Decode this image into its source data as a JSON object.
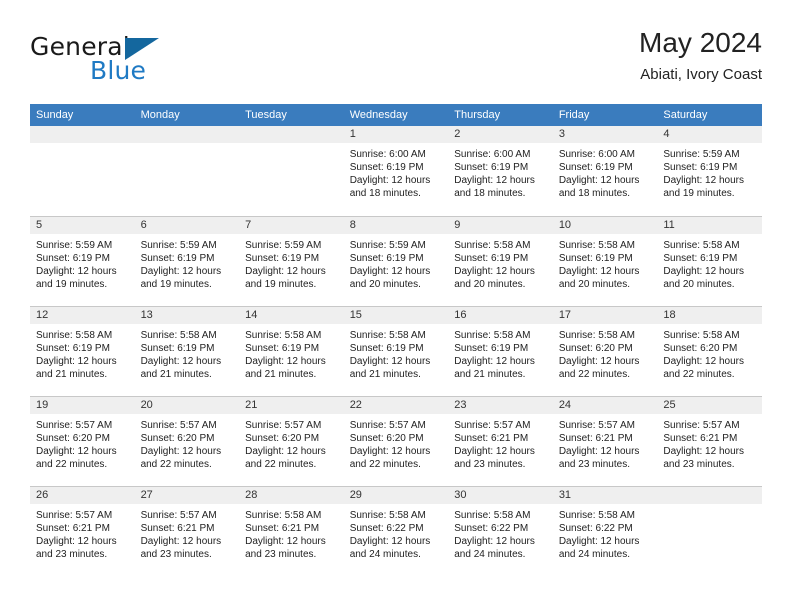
{
  "logo": {
    "text_top": "General",
    "text_bottom": "Blue",
    "icon": "triangle-icon",
    "color_primary": "#1f7ac4",
    "color_dark": "#14679e"
  },
  "header": {
    "title": "May 2024",
    "subtitle": "Abiati, Ivory Coast"
  },
  "theme": {
    "header_blue": "#3a7cbe",
    "band_gray": "#efefef",
    "grid_line": "#c8c8c8"
  },
  "weekday_headers": [
    "Sunday",
    "Monday",
    "Tuesday",
    "Wednesday",
    "Thursday",
    "Friday",
    "Saturday"
  ],
  "labels": {
    "sunrise_prefix": "Sunrise:",
    "sunset_prefix": "Sunset:",
    "daylight_prefix": "Daylight:"
  },
  "weeks": [
    [
      {
        "day": "",
        "empty": true,
        "line1": "",
        "line2": "",
        "line3": "",
        "line4": ""
      },
      {
        "day": "",
        "empty": true,
        "line1": "",
        "line2": "",
        "line3": "",
        "line4": ""
      },
      {
        "day": "",
        "empty": true,
        "line1": "",
        "line2": "",
        "line3": "",
        "line4": ""
      },
      {
        "day": "1",
        "empty": false,
        "line1": "Sunrise: 6:00 AM",
        "line2": "Sunset: 6:19 PM",
        "line3": "Daylight: 12 hours",
        "line4": "and 18 minutes."
      },
      {
        "day": "2",
        "empty": false,
        "line1": "Sunrise: 6:00 AM",
        "line2": "Sunset: 6:19 PM",
        "line3": "Daylight: 12 hours",
        "line4": "and 18 minutes."
      },
      {
        "day": "3",
        "empty": false,
        "line1": "Sunrise: 6:00 AM",
        "line2": "Sunset: 6:19 PM",
        "line3": "Daylight: 12 hours",
        "line4": "and 18 minutes."
      },
      {
        "day": "4",
        "empty": false,
        "line1": "Sunrise: 5:59 AM",
        "line2": "Sunset: 6:19 PM",
        "line3": "Daylight: 12 hours",
        "line4": "and 19 minutes."
      }
    ],
    [
      {
        "day": "5",
        "empty": false,
        "line1": "Sunrise: 5:59 AM",
        "line2": "Sunset: 6:19 PM",
        "line3": "Daylight: 12 hours",
        "line4": "and 19 minutes."
      },
      {
        "day": "6",
        "empty": false,
        "line1": "Sunrise: 5:59 AM",
        "line2": "Sunset: 6:19 PM",
        "line3": "Daylight: 12 hours",
        "line4": "and 19 minutes."
      },
      {
        "day": "7",
        "empty": false,
        "line1": "Sunrise: 5:59 AM",
        "line2": "Sunset: 6:19 PM",
        "line3": "Daylight: 12 hours",
        "line4": "and 19 minutes."
      },
      {
        "day": "8",
        "empty": false,
        "line1": "Sunrise: 5:59 AM",
        "line2": "Sunset: 6:19 PM",
        "line3": "Daylight: 12 hours",
        "line4": "and 20 minutes."
      },
      {
        "day": "9",
        "empty": false,
        "line1": "Sunrise: 5:58 AM",
        "line2": "Sunset: 6:19 PM",
        "line3": "Daylight: 12 hours",
        "line4": "and 20 minutes."
      },
      {
        "day": "10",
        "empty": false,
        "line1": "Sunrise: 5:58 AM",
        "line2": "Sunset: 6:19 PM",
        "line3": "Daylight: 12 hours",
        "line4": "and 20 minutes."
      },
      {
        "day": "11",
        "empty": false,
        "line1": "Sunrise: 5:58 AM",
        "line2": "Sunset: 6:19 PM",
        "line3": "Daylight: 12 hours",
        "line4": "and 20 minutes."
      }
    ],
    [
      {
        "day": "12",
        "empty": false,
        "line1": "Sunrise: 5:58 AM",
        "line2": "Sunset: 6:19 PM",
        "line3": "Daylight: 12 hours",
        "line4": "and 21 minutes."
      },
      {
        "day": "13",
        "empty": false,
        "line1": "Sunrise: 5:58 AM",
        "line2": "Sunset: 6:19 PM",
        "line3": "Daylight: 12 hours",
        "line4": "and 21 minutes."
      },
      {
        "day": "14",
        "empty": false,
        "line1": "Sunrise: 5:58 AM",
        "line2": "Sunset: 6:19 PM",
        "line3": "Daylight: 12 hours",
        "line4": "and 21 minutes."
      },
      {
        "day": "15",
        "empty": false,
        "line1": "Sunrise: 5:58 AM",
        "line2": "Sunset: 6:19 PM",
        "line3": "Daylight: 12 hours",
        "line4": "and 21 minutes."
      },
      {
        "day": "16",
        "empty": false,
        "line1": "Sunrise: 5:58 AM",
        "line2": "Sunset: 6:19 PM",
        "line3": "Daylight: 12 hours",
        "line4": "and 21 minutes."
      },
      {
        "day": "17",
        "empty": false,
        "line1": "Sunrise: 5:58 AM",
        "line2": "Sunset: 6:20 PM",
        "line3": "Daylight: 12 hours",
        "line4": "and 22 minutes."
      },
      {
        "day": "18",
        "empty": false,
        "line1": "Sunrise: 5:58 AM",
        "line2": "Sunset: 6:20 PM",
        "line3": "Daylight: 12 hours",
        "line4": "and 22 minutes."
      }
    ],
    [
      {
        "day": "19",
        "empty": false,
        "line1": "Sunrise: 5:57 AM",
        "line2": "Sunset: 6:20 PM",
        "line3": "Daylight: 12 hours",
        "line4": "and 22 minutes."
      },
      {
        "day": "20",
        "empty": false,
        "line1": "Sunrise: 5:57 AM",
        "line2": "Sunset: 6:20 PM",
        "line3": "Daylight: 12 hours",
        "line4": "and 22 minutes."
      },
      {
        "day": "21",
        "empty": false,
        "line1": "Sunrise: 5:57 AM",
        "line2": "Sunset: 6:20 PM",
        "line3": "Daylight: 12 hours",
        "line4": "and 22 minutes."
      },
      {
        "day": "22",
        "empty": false,
        "line1": "Sunrise: 5:57 AM",
        "line2": "Sunset: 6:20 PM",
        "line3": "Daylight: 12 hours",
        "line4": "and 22 minutes."
      },
      {
        "day": "23",
        "empty": false,
        "line1": "Sunrise: 5:57 AM",
        "line2": "Sunset: 6:21 PM",
        "line3": "Daylight: 12 hours",
        "line4": "and 23 minutes."
      },
      {
        "day": "24",
        "empty": false,
        "line1": "Sunrise: 5:57 AM",
        "line2": "Sunset: 6:21 PM",
        "line3": "Daylight: 12 hours",
        "line4": "and 23 minutes."
      },
      {
        "day": "25",
        "empty": false,
        "line1": "Sunrise: 5:57 AM",
        "line2": "Sunset: 6:21 PM",
        "line3": "Daylight: 12 hours",
        "line4": "and 23 minutes."
      }
    ],
    [
      {
        "day": "26",
        "empty": false,
        "line1": "Sunrise: 5:57 AM",
        "line2": "Sunset: 6:21 PM",
        "line3": "Daylight: 12 hours",
        "line4": "and 23 minutes."
      },
      {
        "day": "27",
        "empty": false,
        "line1": "Sunrise: 5:57 AM",
        "line2": "Sunset: 6:21 PM",
        "line3": "Daylight: 12 hours",
        "line4": "and 23 minutes."
      },
      {
        "day": "28",
        "empty": false,
        "line1": "Sunrise: 5:58 AM",
        "line2": "Sunset: 6:21 PM",
        "line3": "Daylight: 12 hours",
        "line4": "and 23 minutes."
      },
      {
        "day": "29",
        "empty": false,
        "line1": "Sunrise: 5:58 AM",
        "line2": "Sunset: 6:22 PM",
        "line3": "Daylight: 12 hours",
        "line4": "and 24 minutes."
      },
      {
        "day": "30",
        "empty": false,
        "line1": "Sunrise: 5:58 AM",
        "line2": "Sunset: 6:22 PM",
        "line3": "Daylight: 12 hours",
        "line4": "and 24 minutes."
      },
      {
        "day": "31",
        "empty": false,
        "line1": "Sunrise: 5:58 AM",
        "line2": "Sunset: 6:22 PM",
        "line3": "Daylight: 12 hours",
        "line4": "and 24 minutes."
      },
      {
        "day": "",
        "empty": true,
        "line1": "",
        "line2": "",
        "line3": "",
        "line4": ""
      }
    ]
  ]
}
